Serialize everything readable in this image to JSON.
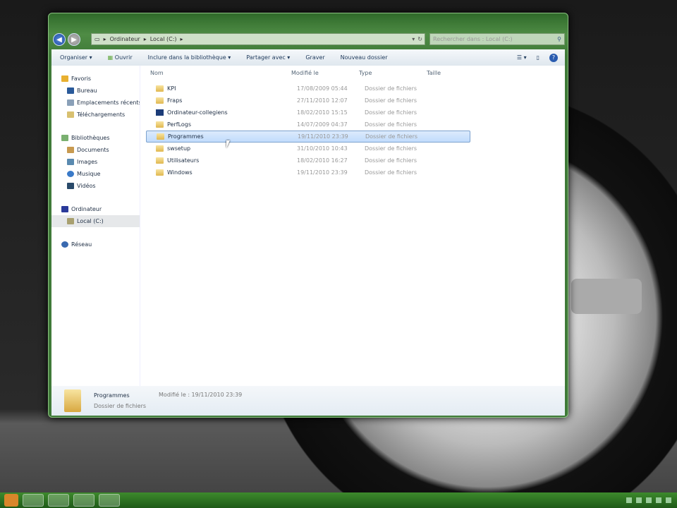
{
  "address": {
    "parts": [
      "Ordinateur",
      "Local (C:)"
    ]
  },
  "search": {
    "placeholder": "Rechercher dans : Local (C:)"
  },
  "toolbar": {
    "organize": "Organiser ▾",
    "open": "Ouvrir",
    "include": "Inclure dans la bibliothèque ▾",
    "share": "Partager avec ▾",
    "burn": "Graver",
    "new_folder": "Nouveau dossier"
  },
  "sidebar": {
    "favorites": "Favoris",
    "fav_items": [
      "Bureau",
      "Emplacements récents",
      "Téléchargements"
    ],
    "libraries": "Bibliothèques",
    "lib_items": [
      "Documents",
      "Images",
      "Musique",
      "Vidéos"
    ],
    "computer": "Ordinateur",
    "local": "Local (C:)",
    "network": "Réseau"
  },
  "columns": {
    "name": "Nom",
    "modified": "Modifié le",
    "type": "Type",
    "size": "Taille"
  },
  "files": [
    {
      "name": "KPI",
      "modified": "17/08/2009 05:44",
      "type": "Dossier de fichiers"
    },
    {
      "name": "Fraps",
      "modified": "27/11/2010 12:07",
      "type": "Dossier de fichiers"
    },
    {
      "name": "Ordinateur-collegiens",
      "modified": "18/02/2010 15:15",
      "type": "Dossier de fichiers"
    },
    {
      "name": "PerfLogs",
      "modified": "14/07/2009 04:37",
      "type": "Dossier de fichiers"
    },
    {
      "name": "Programmes",
      "modified": "19/11/2010 23:39",
      "type": "Dossier de fichiers"
    },
    {
      "name": "swsetup",
      "modified": "31/10/2010 10:43",
      "type": "Dossier de fichiers"
    },
    {
      "name": "Utilisateurs",
      "modified": "18/02/2010 16:27",
      "type": "Dossier de fichiers"
    },
    {
      "name": "Windows",
      "modified": "19/11/2010 23:39",
      "type": "Dossier de fichiers"
    }
  ],
  "details": {
    "name": "Programmes",
    "modified_label": "Modifié le : 19/11/2010 23:39",
    "type": "Dossier de fichiers"
  }
}
